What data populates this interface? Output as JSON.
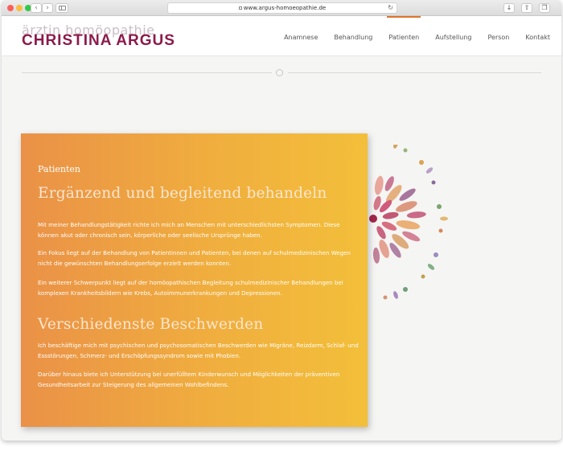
{
  "browser": {
    "url": "www.argus-homoeopathie.de",
    "back": "‹",
    "forward": "›",
    "reload": "↻",
    "download_icon": "download-icon",
    "share_icon": "share-icon",
    "tabs_icon": "tabs-icon"
  },
  "site": {
    "logo_top": "ärztin homöopathie",
    "logo_main": "CHRISTINA ARGUS",
    "brand_color": "#8c1a4b",
    "accent_color": "#e0742a",
    "menu": [
      {
        "label": "Anamnese"
      },
      {
        "label": "Behandlung"
      },
      {
        "label": "Patienten"
      },
      {
        "label": "Aufstellung"
      },
      {
        "label": "Person"
      },
      {
        "label": "Kontakt"
      }
    ],
    "active_menu": "Patienten"
  },
  "content": {
    "kicker": "Patienten",
    "heading1": "Ergänzend und begleitend behandeln",
    "p1": "Mit meiner Behandlungstätigkeit richte ich mich an Menschen mit unterschiedlichsten Symptomen. Diese können akut oder chronisch sein, körperliche oder seelische Ursprünge haben.",
    "p2": "Ein Fokus liegt auf der Behandlung von Patientinnen und Patienten, bei denen auf schulmedizinischen Wegen nicht die gewünschten Behandlungserfolge erzielt werden konnten.",
    "p3": "Ein weiterer Schwerpunkt liegt auf der homöopathischen Begleitung schulmedizinischer Behandlungen bei komplexen Krankheitsbildern wie Krebs, Autoimmunerkrankungen und Depressionen.",
    "heading2": "Verschiedenste Beschwerden",
    "p4": "Ich beschäftige mich mit psychischen und psychosomatischen Beschwerden wie Migräne, Reizdarm, Schlaf- und Essstörungen, Schmerz- und Erschöpfungssyndrom sowie mit Phobien.",
    "p5": "Darüber hinaus biete ich Unterstützung bei unerfülltem Kinderwunsch und Möglichkeiten der präventiven Gesundheitsarbeit zur Steigerung des allgemeinen Wohlbefindens."
  }
}
